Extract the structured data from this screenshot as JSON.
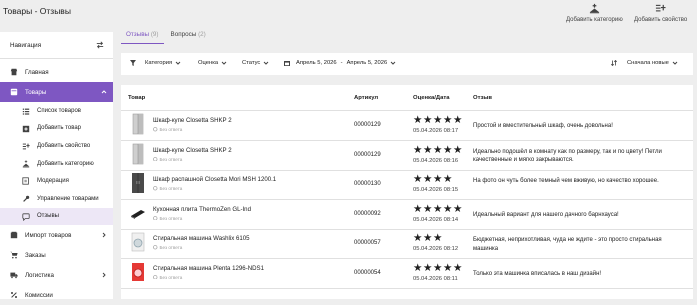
{
  "header": {
    "title": "Товары - Отзывы",
    "actions": [
      {
        "label": "Добавить категорию",
        "icon": "add-category-icon"
      },
      {
        "label": "Добавить свойство",
        "icon": "add-property-icon"
      }
    ]
  },
  "sidebar": {
    "title": "Навигация",
    "items": [
      {
        "label": "Главная",
        "icon": "store-icon"
      },
      {
        "label": "Товары",
        "icon": "box-icon",
        "active": true
      },
      {
        "label": "Список товаров",
        "icon": "list-icon",
        "sub": true
      },
      {
        "label": "Добавить товар",
        "icon": "add-box-icon",
        "sub": true
      },
      {
        "label": "Добавить свойство",
        "icon": "add-list-icon",
        "sub": true
      },
      {
        "label": "Добавить категорию",
        "icon": "add-category-icon",
        "sub": true
      },
      {
        "label": "Модерация",
        "icon": "edit-icon",
        "sub": true
      },
      {
        "label": "Управление товарами",
        "icon": "wrench-icon",
        "sub": true
      },
      {
        "label": "Отзывы",
        "icon": "chat-icon",
        "sub": true,
        "selected": true
      },
      {
        "label": "Импорт товаров",
        "icon": "import-icon"
      },
      {
        "label": "Заказы",
        "icon": "cart-icon"
      },
      {
        "label": "Логистика",
        "icon": "truck-icon"
      },
      {
        "label": "Комиссии",
        "icon": "percent-icon"
      }
    ]
  },
  "tabs": [
    {
      "label": "Отзывы",
      "count": "(9)",
      "active": true
    },
    {
      "label": "Вопросы",
      "count": "(2)"
    }
  ],
  "filters": {
    "category": "Категория",
    "rating": "Оценка",
    "status": "Статус",
    "date_from": "Апрель 5, 2026",
    "date_sep": "-",
    "date_to": "Апрель 5, 2026",
    "sort": "Сначала новые"
  },
  "table": {
    "columns": [
      "Товар",
      "Артикул",
      "Оценка/Дата",
      "Отзыв"
    ],
    "rows": [
      {
        "product": "Шкаф-купе Closetta SHKP 2",
        "status": "Без ответа",
        "sku": "00000129",
        "rating": 5,
        "date": "05.04.2026 08:17",
        "review": "Простой и вместительный шкаф, очень довольна!",
        "thumb": "wardrobe"
      },
      {
        "product": "Шкаф-купе Closetta SHKP 2",
        "status": "Без ответа",
        "sku": "00000129",
        "rating": 5,
        "date": "05.04.2026 08:16",
        "review": "Идеально подошёл в комнату как по размеру, так и по цвету! Петли качественные и мягко закрываются.",
        "thumb": "wardrobe"
      },
      {
        "product": "Шкаф распашной Closetta Mori MSH 1200.1",
        "status": "Без ответа",
        "sku": "00000130",
        "rating": 4,
        "date": "05.04.2026 08:15",
        "review": "На фото он чуть более темный чем вживую, но качество хорошее.",
        "thumb": "wardrobe-dark"
      },
      {
        "product": "Кухонная плита ThermoZen GL-Ind",
        "status": "Без ответа",
        "sku": "00000092",
        "rating": 5,
        "date": "05.04.2026 08:14",
        "review": "Идеальный вариант для нашего дачного барнхауса!",
        "thumb": "stove"
      },
      {
        "product": "Стиральная машина Washlix 6105",
        "status": "Без ответа",
        "sku": "00000057",
        "rating": 3,
        "date": "05.04.2026 08:12",
        "review": "Бюджетная, неприхотливая, чуда не ждите - это просто стиральная машинка",
        "thumb": "washer"
      },
      {
        "product": "Стиральная машина Plenta 1296-NDS1",
        "status": "Без ответа",
        "sku": "00000054",
        "rating": 5,
        "date": "05.04.2026 08:11",
        "review": "Только эта машинка вписалась в наш дизайн!",
        "thumb": "washer-red"
      }
    ]
  }
}
